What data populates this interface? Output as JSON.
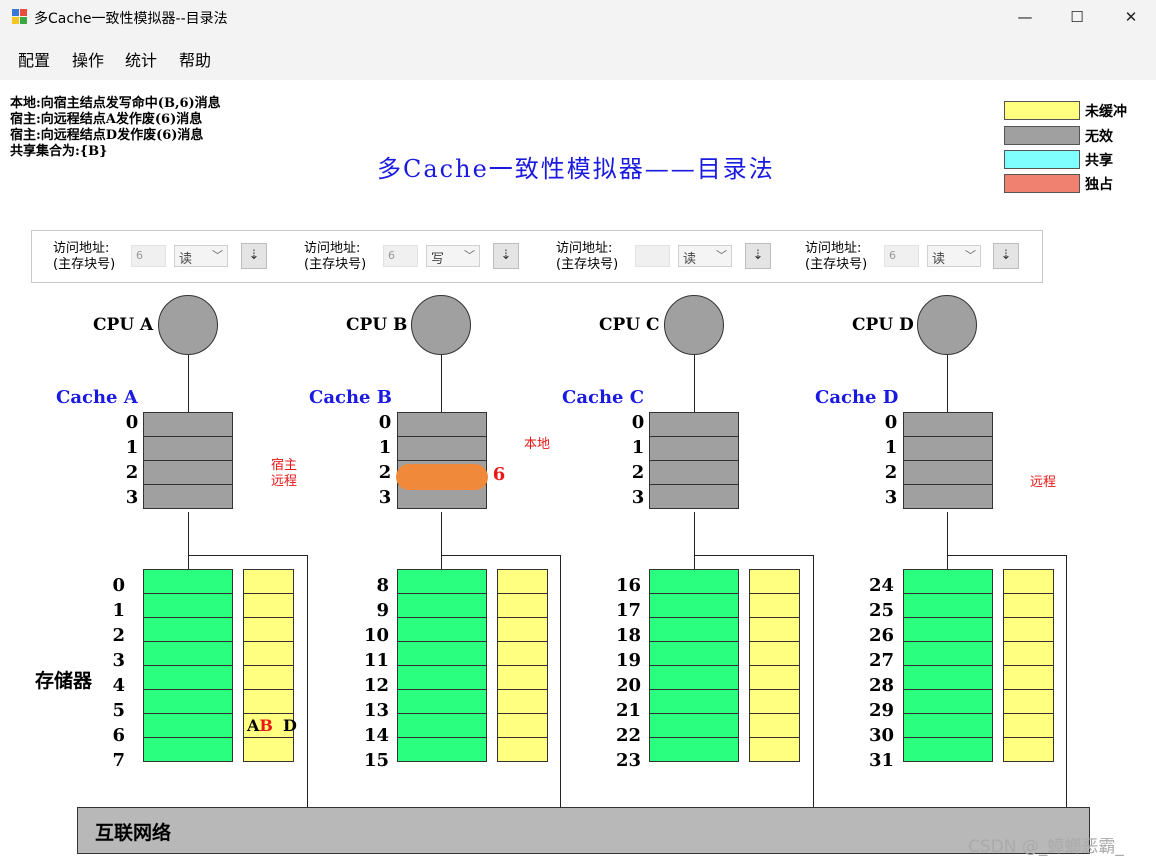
{
  "window": {
    "title": "多Cache一致性模拟器--目录法",
    "controls": {
      "minimize": "—",
      "maximize": "☐",
      "close": "✕"
    }
  },
  "menu": [
    "配置",
    "操作",
    "统计",
    "帮助"
  ],
  "messages": [
    "本地:向宿主结点发写命中(B,6)消息",
    "宿主:向远程结点A发作废(6)消息",
    "宿主:向远程结点D发作废(6)消息",
    "共享集合为:{B}"
  ],
  "main_title": "多Cache一致性模拟器——目录法",
  "legend": [
    {
      "label": "未缓冲",
      "color": "#ffff80"
    },
    {
      "label": "无效",
      "color": "#a0a0a0"
    },
    {
      "label": "共享",
      "color": "#80ffff"
    },
    {
      "label": "独占",
      "color": "#f08070"
    }
  ],
  "controls": [
    {
      "label1": "访问地址:",
      "label2": "(主存块号)",
      "address": "6",
      "op": "读"
    },
    {
      "label1": "访问地址:",
      "label2": "(主存块号)",
      "address": "6",
      "op": "写"
    },
    {
      "label1": "访问地址:",
      "label2": "(主存块号)",
      "address": "",
      "op": "读"
    },
    {
      "label1": "访问地址:",
      "label2": "(主存块号)",
      "address": "6",
      "op": "读"
    }
  ],
  "step_button_icon": "down-arrow-icon",
  "cpus": [
    {
      "cpu": "CPU  A",
      "cache": "Cache  A",
      "note": "宿主\n远程",
      "cache_lines": [
        "0",
        "1",
        "2",
        "3"
      ],
      "mem_blocks": [
        "0",
        "1",
        "2",
        "3",
        "4",
        "5",
        "6",
        "7"
      ]
    },
    {
      "cpu": "CPU  B",
      "cache": "Cache  B",
      "note": "本地",
      "cache_lines": [
        "0",
        "1",
        "2",
        "3"
      ],
      "mem_blocks": [
        "8",
        "9",
        "10",
        "11",
        "12",
        "13",
        "14",
        "15"
      ],
      "cache_tag": "6"
    },
    {
      "cpu": "CPU  C",
      "cache": "Cache  C",
      "note": "",
      "cache_lines": [
        "0",
        "1",
        "2",
        "3"
      ],
      "mem_blocks": [
        "16",
        "17",
        "18",
        "19",
        "20",
        "21",
        "22",
        "23"
      ]
    },
    {
      "cpu": "CPU  D",
      "cache": "Cache  D",
      "note": "远程",
      "cache_lines": [
        "0",
        "1",
        "2",
        "3"
      ],
      "mem_blocks": [
        "24",
        "25",
        "26",
        "27",
        "28",
        "29",
        "30",
        "31"
      ]
    }
  ],
  "directory_entry": {
    "A": "A",
    "B": "B",
    "D": "D"
  },
  "storage_label": "存储器",
  "network_label": "互联网络",
  "watermark": "CSDN @_蟑螂恶霸_"
}
